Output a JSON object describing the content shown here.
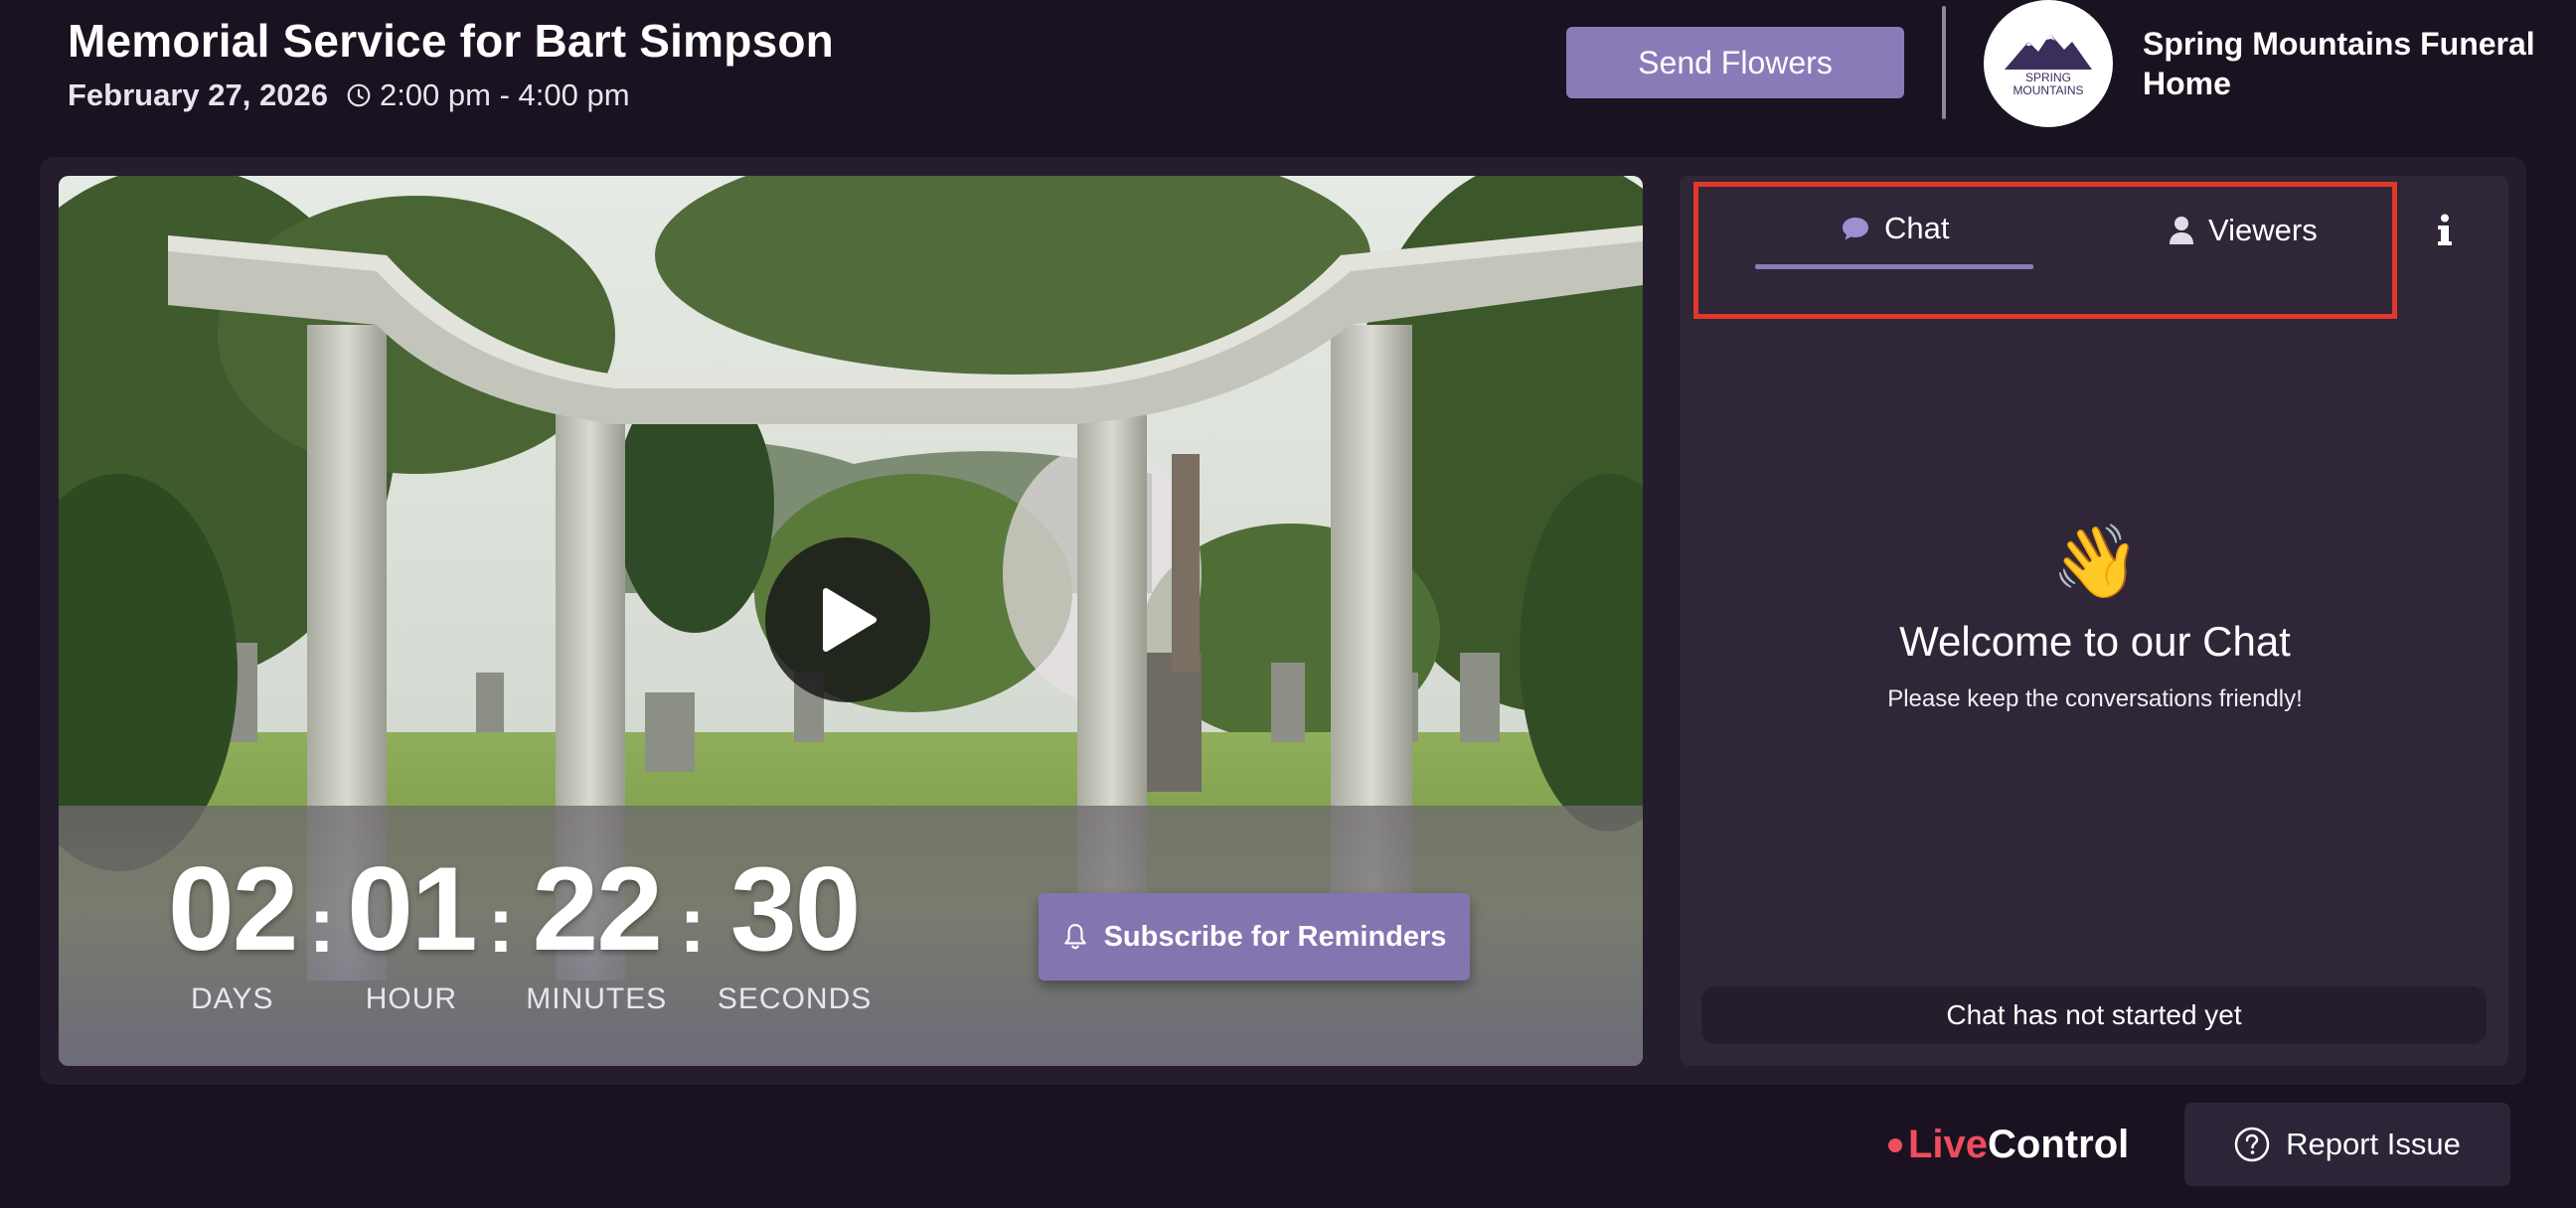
{
  "header": {
    "title": "Memorial Service for Bart Simpson",
    "date": "February 27, 2026",
    "time": "2:00 pm - 4:00 pm",
    "send_flowers_label": "Send Flowers",
    "logo_text": "SPRING\nMOUNTAINS",
    "funeral_home_name": "Spring Mountains Funeral Home"
  },
  "video": {
    "countdown": [
      {
        "value": "02",
        "label": "DAYS"
      },
      {
        "value": "01",
        "label": "HOUR"
      },
      {
        "value": "22",
        "label": "MINUTES"
      },
      {
        "value": "30",
        "label": "SECONDS"
      }
    ],
    "subscribe_label": "Subscribe for Reminders"
  },
  "chat": {
    "tabs": [
      {
        "label": "Chat",
        "icon": "chat-bubble-icon",
        "active": true
      },
      {
        "label": "Viewers",
        "icon": "person-icon",
        "active": false
      }
    ],
    "wave_emoji": "👋",
    "welcome_title": "Welcome to our Chat",
    "welcome_subtitle": "Please keep the conversations friendly!",
    "status": "Chat has not started yet"
  },
  "footer": {
    "brand_live": "Live",
    "brand_control": "Control",
    "report_label": "Report Issue"
  },
  "colors": {
    "background": "#1a1220",
    "accent": "#8a7bb8",
    "highlight_border": "#e0382b",
    "brand_red": "#ef4d5f"
  }
}
